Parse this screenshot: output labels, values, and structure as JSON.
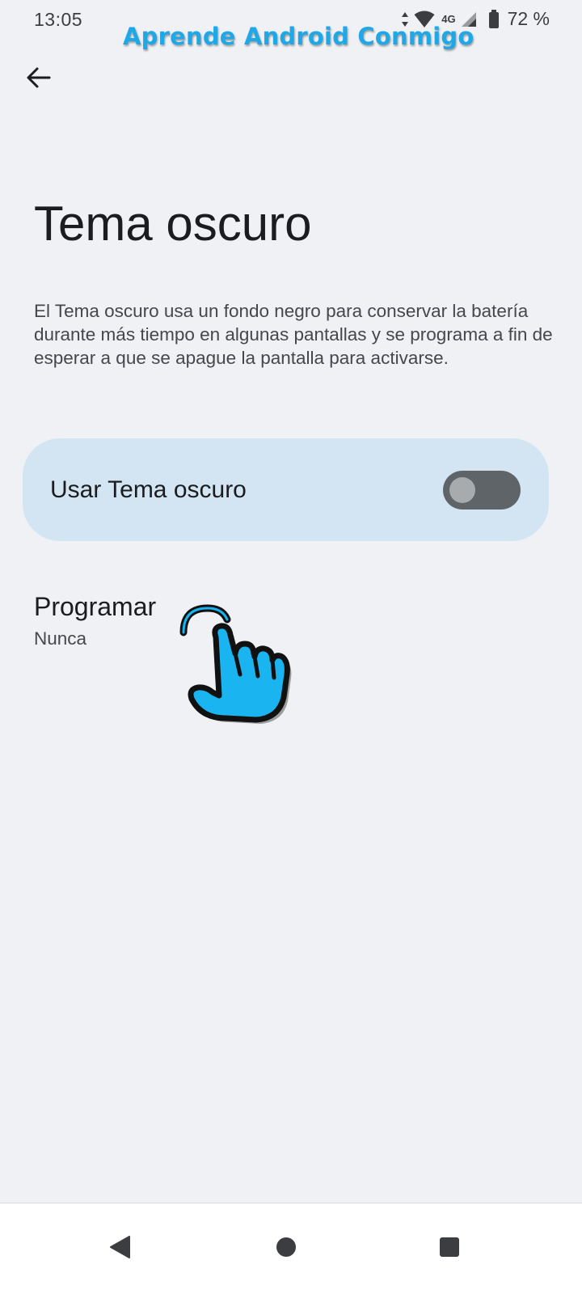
{
  "status_bar": {
    "time": "13:05",
    "network_label": "4G",
    "battery_percent": "72 %",
    "icons": [
      "data-arrows-icon",
      "wifi-icon",
      "signal-icon",
      "battery-icon"
    ]
  },
  "watermark": {
    "text": "Aprende Android Conmigo",
    "color": "#1fa8e8"
  },
  "header": {
    "back_icon": "arrow-left-icon"
  },
  "page": {
    "title": "Tema oscuro",
    "description": "El Tema oscuro usa un fondo negro para conservar la batería durante más tiempo en algunas pantallas y se programa a fin de esperar a que se apague la pantalla para activarse."
  },
  "settings": {
    "use_dark_theme": {
      "label": "Usar Tema oscuro",
      "enabled": false,
      "card_color": "#d3e5f3"
    },
    "schedule": {
      "label": "Programar",
      "value": "Nunca"
    }
  },
  "overlay": {
    "pointer_icon": "tap-hand-icon",
    "pointer_color": "#1ab4f0"
  },
  "nav_bar": {
    "icons": [
      "back-triangle-icon",
      "home-circle-icon",
      "recents-square-icon"
    ]
  },
  "colors": {
    "background": "#f0f1f4",
    "text_primary": "#1b1c1f",
    "text_secondary": "#44474c"
  }
}
